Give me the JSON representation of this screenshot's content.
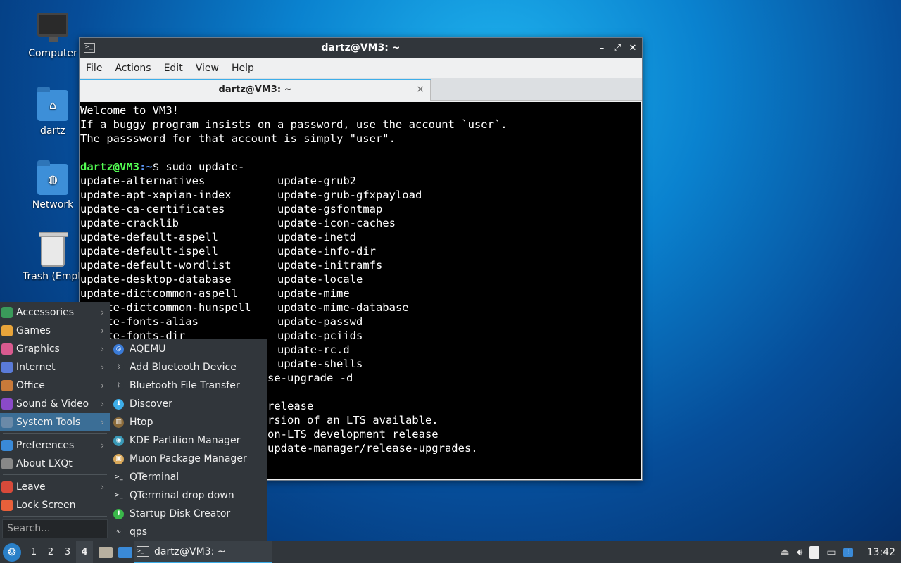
{
  "desktop": {
    "icons": [
      {
        "label": "Computer",
        "icon": "computer-icon"
      },
      {
        "label": "dartz",
        "icon": "home-folder-icon"
      },
      {
        "label": "Network",
        "icon": "network-folder-icon"
      },
      {
        "label": "Trash (Empty)",
        "icon": "trash-icon"
      }
    ]
  },
  "window": {
    "title": "dartz@VM3: ~",
    "menu": [
      "File",
      "Actions",
      "Edit",
      "View",
      "Help"
    ],
    "tab_label": "dartz@VM3: ~",
    "tab_close": "×",
    "controls": {
      "minimize": "–",
      "maximize": "⤢",
      "close": "✕"
    }
  },
  "terminal": {
    "welcome": [
      "Welcome to VM3!",
      "If a buggy program insists on a password, use the account `user`.",
      "The passsword for that account is simply \"user\"."
    ],
    "prompt_user": "dartz@VM3",
    "prompt_path": ":~",
    "prompt_cmd": "$ sudo update-",
    "completions": [
      [
        "update-alternatives",
        "update-grub2"
      ],
      [
        "update-apt-xapian-index",
        "update-grub-gfxpayload"
      ],
      [
        "update-ca-certificates",
        "update-gsfontmap"
      ],
      [
        "update-cracklib",
        "update-icon-caches"
      ],
      [
        "update-default-aspell",
        "update-inetd"
      ],
      [
        "update-default-ispell",
        "update-info-dir"
      ],
      [
        "update-default-wordlist",
        "update-initramfs"
      ],
      [
        "update-desktop-database",
        "update-locale"
      ],
      [
        "update-dictcommon-aspell",
        "update-mime"
      ],
      [
        "update-dictcommon-hunspell",
        "update-mime-database"
      ],
      [
        "update-fonts-alias",
        "update-passwd"
      ],
      [
        "update-fonts-dir",
        "update-pciids"
      ],
      [
        "",
        "update-rc.d"
      ],
      [
        "",
        "update-shells"
      ]
    ],
    "tail": [
      "se-upgrade -d",
      "",
      "release",
      "rsion of an LTS available.",
      "on-LTS development release",
      "update-manager/release-upgrades."
    ]
  },
  "start_menu": {
    "items": [
      {
        "label": "Accessories",
        "color": "#3a9a5a",
        "arrow": true
      },
      {
        "label": "Games",
        "color": "#e8a43a",
        "arrow": true
      },
      {
        "label": "Graphics",
        "color": "#d95a8f",
        "arrow": true
      },
      {
        "label": "Internet",
        "color": "#5a7bd8",
        "arrow": true
      },
      {
        "label": "Office",
        "color": "#c87a3a",
        "arrow": true
      },
      {
        "label": "Sound & Video",
        "color": "#8a4ac8",
        "arrow": true
      },
      {
        "label": "System Tools",
        "color": "#6a8aa8",
        "arrow": true
      },
      {
        "label": "Preferences",
        "color": "#3a8ad8",
        "arrow": true
      },
      {
        "label": "About LXQt",
        "color": "#888888",
        "arrow": false
      },
      {
        "label": "Leave",
        "color": "#d84a3a",
        "arrow": true
      },
      {
        "label": "Lock Screen",
        "color": "#e8603a",
        "arrow": false
      }
    ],
    "search_placeholder": "Search...",
    "arrow": "›"
  },
  "system_tools": [
    {
      "label": "AQEMU",
      "color": "#3a7bd8",
      "glyph": "◎"
    },
    {
      "label": "Add Bluetooth Device",
      "color": "#31363b",
      "glyph": "ᛒ"
    },
    {
      "label": "Bluetooth File Transfer",
      "color": "#31363b",
      "glyph": "ᛒ"
    },
    {
      "label": "Discover",
      "color": "#3daee9",
      "glyph": "⬇"
    },
    {
      "label": "Htop",
      "color": "#8a6a3a",
      "glyph": "▥"
    },
    {
      "label": "KDE Partition Manager",
      "color": "#3a9ab8",
      "glyph": "◉"
    },
    {
      "label": "Muon Package Manager",
      "color": "#d8a85a",
      "glyph": "▣"
    },
    {
      "label": "QTerminal",
      "color": "#31363b",
      "glyph": ">_"
    },
    {
      "label": "QTerminal drop down",
      "color": "#31363b",
      "glyph": ">_"
    },
    {
      "label": "Startup Disk Creator",
      "color": "#3ab84a",
      "glyph": "⬇"
    },
    {
      "label": "qps",
      "color": "#31363b",
      "glyph": "∿"
    }
  ],
  "taskbar": {
    "desktops": [
      "1",
      "2",
      "3",
      "4"
    ],
    "current_desktop": "4",
    "task_label": "dartz@VM3: ~",
    "clock": "13:42"
  }
}
